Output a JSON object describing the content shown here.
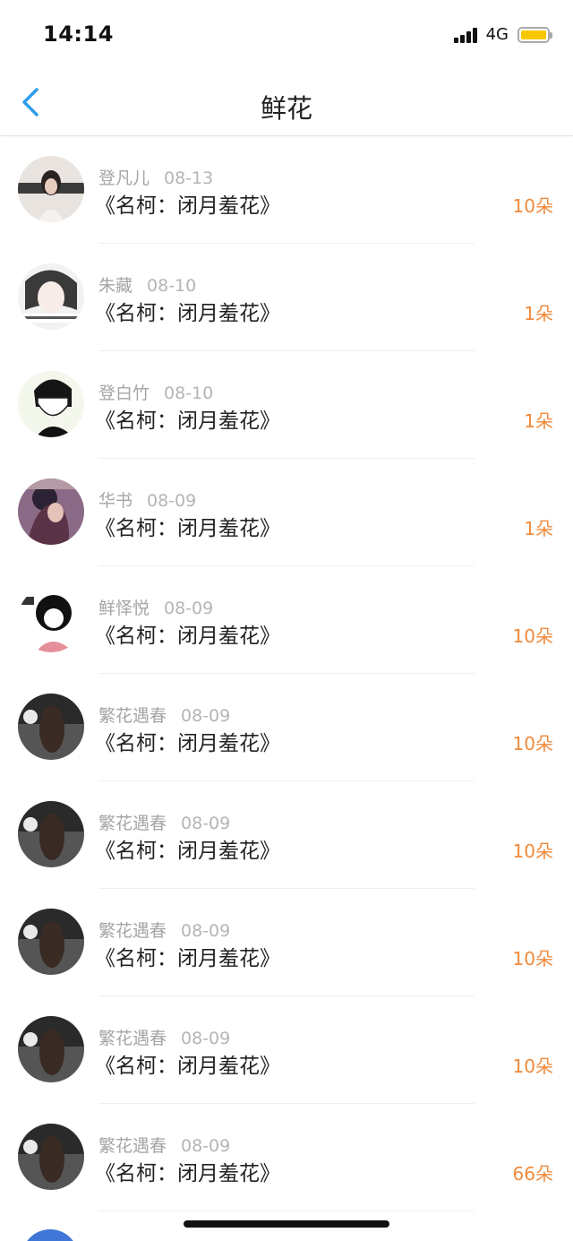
{
  "status_bar": {
    "time": "14:14",
    "network": "4G",
    "battery_color": "#f7c800"
  },
  "nav": {
    "title": "鲜花",
    "back_icon": "chevron-left-icon",
    "accent": "#2f9ceb"
  },
  "count_color": "#f08a3c",
  "items": [
    {
      "name": "登凡儿",
      "date": "08-13",
      "work": "《名柯：闭月羞花》",
      "count": "10朵"
    },
    {
      "name": "朱藏",
      "date": "08-10",
      "work": "《名柯：闭月羞花》",
      "count": "1朵"
    },
    {
      "name": "登白竹",
      "date": "08-10",
      "work": "《名柯：闭月羞花》",
      "count": "1朵"
    },
    {
      "name": "华书",
      "date": "08-09",
      "work": "《名柯：闭月羞花》",
      "count": "1朵"
    },
    {
      "name": "鲜怿悦",
      "date": "08-09",
      "work": "《名柯：闭月羞花》",
      "count": "10朵"
    },
    {
      "name": "繁花遇春",
      "date": "08-09",
      "work": "《名柯：闭月羞花》",
      "count": "10朵"
    },
    {
      "name": "繁花遇春",
      "date": "08-09",
      "work": "《名柯：闭月羞花》",
      "count": "10朵"
    },
    {
      "name": "繁花遇春",
      "date": "08-09",
      "work": "《名柯：闭月羞花》",
      "count": "10朵"
    },
    {
      "name": "繁花遇春",
      "date": "08-09",
      "work": "《名柯：闭月羞花》",
      "count": "10朵"
    },
    {
      "name": "繁花遇春",
      "date": "08-09",
      "work": "《名柯：闭月羞花》",
      "count": "66朵"
    }
  ]
}
